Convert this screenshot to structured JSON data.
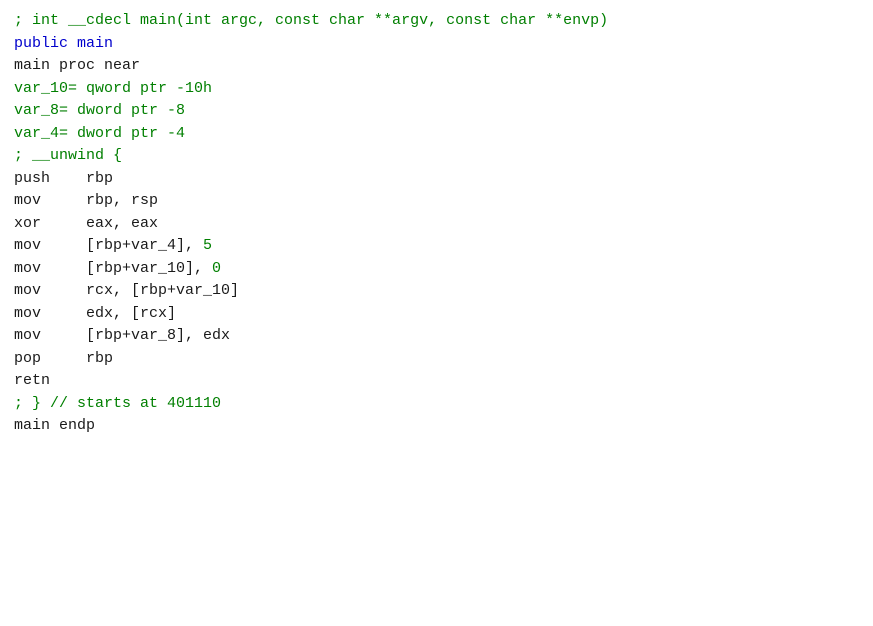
{
  "code": {
    "lines": [
      {
        "id": "line1",
        "type": "comment",
        "text": "; int __cdecl main(int argc, const char **argv, const char **envp)"
      },
      {
        "id": "line2",
        "type": "keyword",
        "text": "public main"
      },
      {
        "id": "line3",
        "type": "normal",
        "text": "main proc near"
      },
      {
        "id": "line4",
        "type": "empty",
        "text": ""
      },
      {
        "id": "line5",
        "type": "var-decl",
        "text": "var_10= qword ptr -10h"
      },
      {
        "id": "line6",
        "type": "var-decl",
        "text": "var_8= dword ptr -8"
      },
      {
        "id": "line7",
        "type": "var-decl",
        "text": "var_4= dword ptr -4"
      },
      {
        "id": "line8",
        "type": "empty",
        "text": ""
      },
      {
        "id": "line9",
        "type": "comment",
        "text": "; __unwind {"
      },
      {
        "id": "line10",
        "type": "instruction",
        "text": "push    rbp"
      },
      {
        "id": "line11",
        "type": "instruction",
        "text": "mov     rbp, rsp"
      },
      {
        "id": "line12",
        "type": "instruction",
        "text": "xor     eax, eax"
      },
      {
        "id": "line13",
        "type": "instruction-num",
        "text": "mov     [rbp+var_4], 5"
      },
      {
        "id": "line14",
        "type": "instruction-num",
        "text": "mov     [rbp+var_10], 0"
      },
      {
        "id": "line15",
        "type": "instruction",
        "text": "mov     rcx, [rbp+var_10]"
      },
      {
        "id": "line16",
        "type": "instruction",
        "text": "mov     edx, [rcx]"
      },
      {
        "id": "line17",
        "type": "instruction",
        "text": "mov     [rbp+var_8], edx"
      },
      {
        "id": "line18",
        "type": "instruction",
        "text": "pop     rbp"
      },
      {
        "id": "line19",
        "type": "instruction",
        "text": "retn"
      },
      {
        "id": "line20",
        "type": "comment",
        "text": "; } // starts at 401110"
      },
      {
        "id": "line21",
        "type": "normal",
        "text": "main endp"
      }
    ]
  }
}
